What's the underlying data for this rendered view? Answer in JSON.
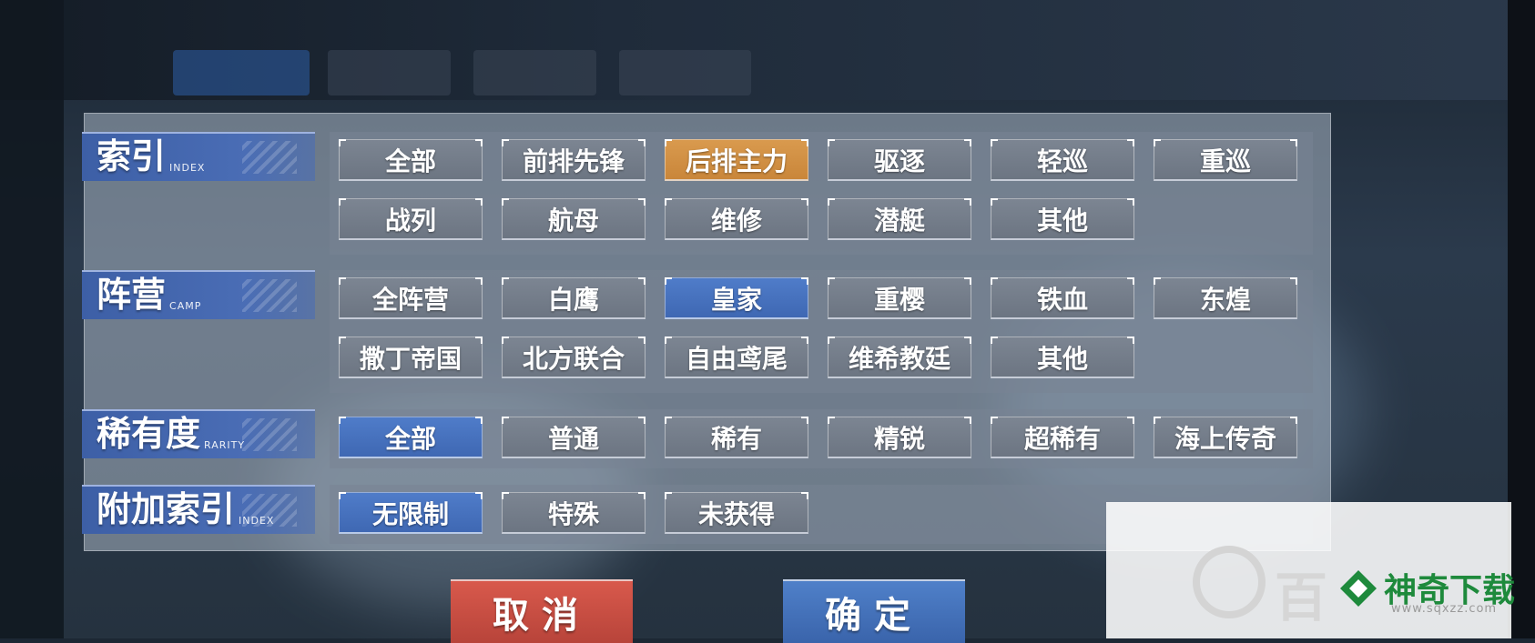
{
  "sections": [
    {
      "label": "索引",
      "sub": "INDEX",
      "options": [
        "全部",
        "前排先锋",
        "后排主力",
        "驱逐",
        "轻巡",
        "重巡",
        "战列",
        "航母",
        "维修",
        "潜艇",
        "其他"
      ]
    },
    {
      "label": "阵营",
      "sub": "CAMP",
      "options": [
        "全阵营",
        "白鹰",
        "皇家",
        "重樱",
        "铁血",
        "东煌",
        "撒丁帝国",
        "北方联合",
        "自由鸢尾",
        "维希教廷",
        "其他"
      ]
    },
    {
      "label": "稀有度",
      "sub": "RARITY",
      "options": [
        "全部",
        "普通",
        "稀有",
        "精锐",
        "超稀有",
        "海上传奇"
      ]
    },
    {
      "label": "附加索引",
      "sub": "INDEX",
      "options": [
        "无限制",
        "特殊",
        "未获得"
      ]
    }
  ],
  "selected": {
    "0": 2,
    "1": 2,
    "2": 0,
    "3": 0
  },
  "selected_color": {
    "0": "orange",
    "1": "blue",
    "2": "blue",
    "3": "blue"
  },
  "buttons": {
    "cancel": "取消",
    "confirm": "确定"
  },
  "watermark": {
    "name": "神奇下载",
    "url": "www.sqxzz.com",
    "text": "百"
  },
  "colors": {
    "accent_blue": "#3f68b3",
    "accent_orange": "#c9863a",
    "cancel_red": "#c24d42",
    "panel_label": "#4a6db5"
  }
}
